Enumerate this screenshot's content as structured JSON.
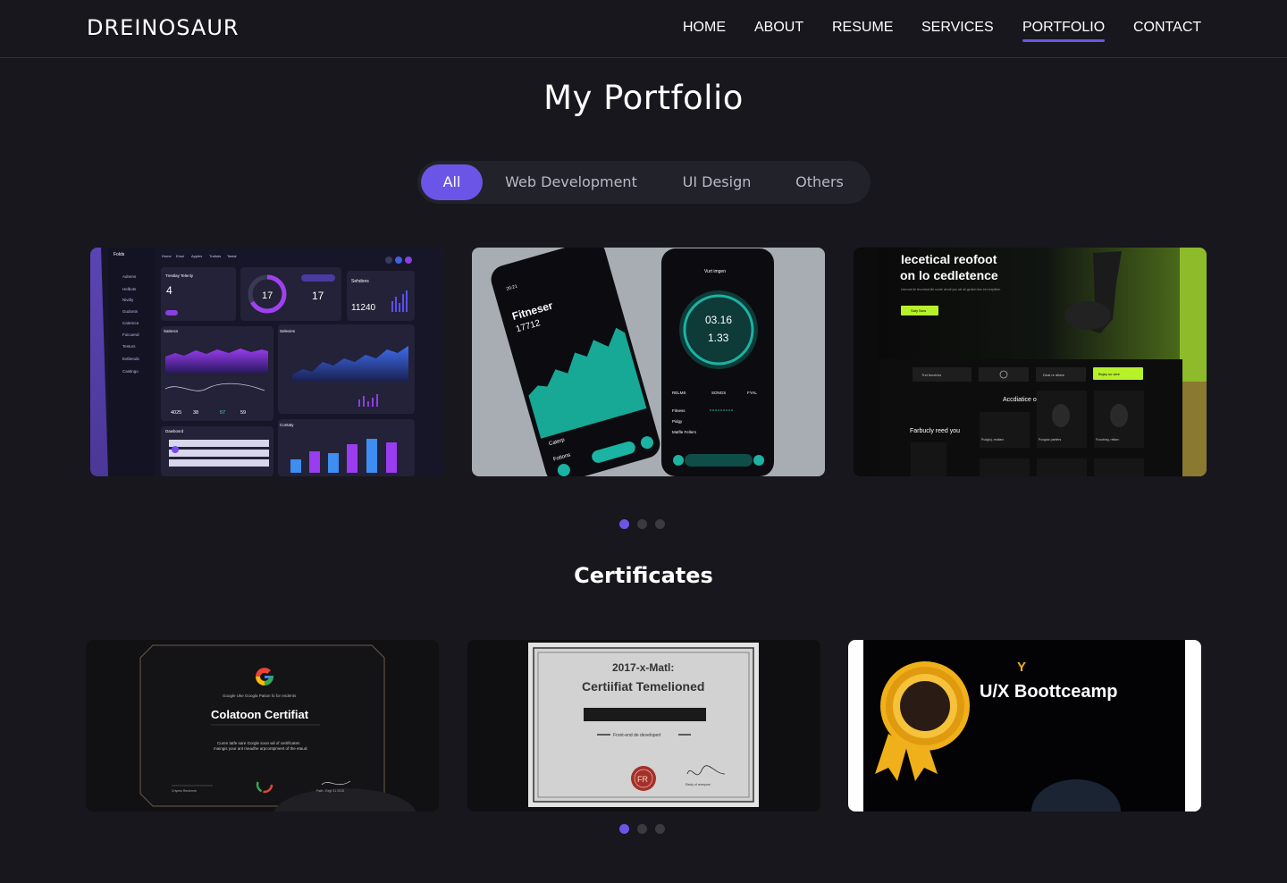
{
  "header": {
    "logo": "DREINOSAUR",
    "nav": [
      "HOME",
      "ABOUT",
      "RESUME",
      "SERVICES",
      "PORTFOLIO",
      "CONTACT"
    ],
    "active_nav": "PORTFOLIO"
  },
  "portfolio": {
    "title": "My Portfolio",
    "tabs": [
      "All",
      "Web Development",
      "UI Design",
      "Others"
    ],
    "active_tab": "All",
    "projects": [
      {
        "kind": "dashboard",
        "menu": [
          "Folds",
          "Adnens",
          "Helbots",
          "Nivdiy",
          "Gudonts",
          "Caterece",
          "Foicuend",
          "Testurs",
          "Extbends",
          "Castingo"
        ],
        "tabs": [
          "Home",
          "Emul",
          "Apples",
          "Traltuts",
          "Tastal"
        ],
        "card1_title": "Trestlay Telenly",
        "card1_value": "4",
        "ring_value": "17",
        "card2_value": "17",
        "card3_title": "Sehdons",
        "card3_value": "11240",
        "chart1_title": "Satnecs",
        "chart2_title": "Selevies",
        "stats": [
          "4025",
          "38",
          "57",
          "59"
        ],
        "table_title": "Dawbosrd",
        "bars_title": "Contaty"
      },
      {
        "kind": "mobile",
        "phone1_title": "Fitneser",
        "phone1_value": "17712",
        "phone1_caption": "Caterp",
        "phone1_footer": "Fotions",
        "phone2_title": "Vurt imgen",
        "phone2_time": "03.16",
        "phone2_value": "1.33",
        "phone2_tabs": [
          "RELMS",
          "SONGS",
          "FYAL"
        ],
        "phone2_rows": [
          "Fitness",
          "Pidgy",
          "Matfle Fellers"
        ],
        "phone1_clock": "20:21"
      },
      {
        "kind": "landing",
        "headline": "Iecetical reofoot",
        "headline2": "on lo cedletence",
        "subtext": "Usevuts ile tecorreat ille sodre dendl you wit all gedlurt itse eel reepttiee.",
        "cta": "Saty Now",
        "section": "Accdiatice of Frencs",
        "aside_title": "Farbucly reed you",
        "chips": [
          "Trst funvtres",
          "Deal re altare",
          "Bujey so wee"
        ],
        "products": [
          "Pudgloj, reoltarc",
          "Poogiac partiers",
          "Fuoobing, reltarc"
        ]
      }
    ],
    "pagination": {
      "count": 3,
      "active": 0
    }
  },
  "certificates": {
    "title": "Certificates",
    "items": [
      {
        "kind": "google",
        "small": "Google Uke Googla Pation fo for endents",
        "title": "Colatoon Certifiat",
        "body1": "Curen tatfe sare Gorgle soon wil of certificaten",
        "body2": "maingis your ant meadhe arpcontpment of the etaud.",
        "sign_left": "Crtymis Reclemnt",
        "sign_right": "Pattl - Exgr 31 2018"
      },
      {
        "kind": "classic",
        "line1": "2017-x-Matl:",
        "line2": "Certiifiat Temelioned",
        "caption": "Front-end de developert",
        "seal": "FR",
        "sign_label": "Raoly of renepore"
      },
      {
        "kind": "bootcamp",
        "title": "U/X Boottceamp",
        "mark": "Y"
      }
    ],
    "pagination": {
      "count": 3,
      "active": 0
    }
  },
  "colors": {
    "accent": "#6b55e6",
    "background": "#17171d",
    "surface": "#22222a",
    "lime": "#b7f12a",
    "teal": "#1bb3a3"
  }
}
